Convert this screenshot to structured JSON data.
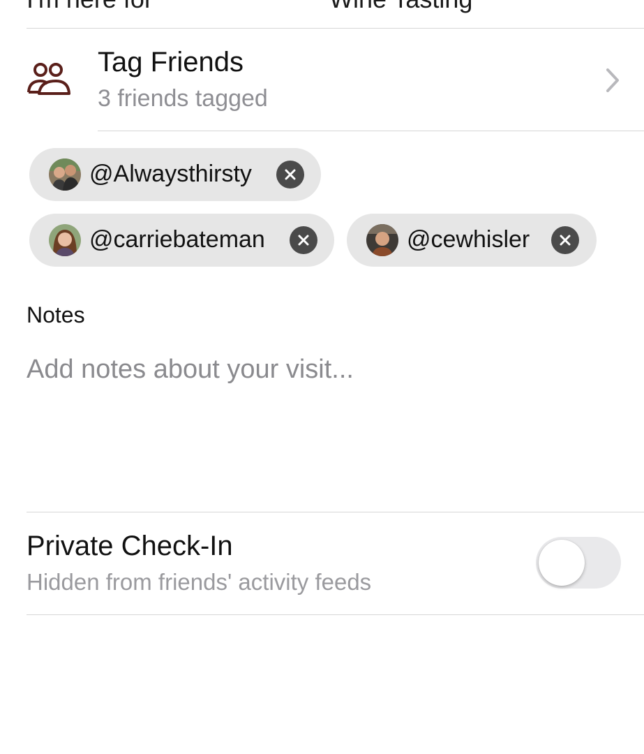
{
  "header_row": {
    "label": "I'm here for",
    "value": "Wine Tasting"
  },
  "tag_friends": {
    "title": "Tag Friends",
    "subtitle": "3 friends tagged",
    "icon": "people-icon",
    "accent_color": "#5a1f1a"
  },
  "tagged_friends": [
    {
      "handle": "@Alwaysthirsty",
      "avatar": "couple-photo"
    },
    {
      "handle": "@carriebateman",
      "avatar": "woman-photo"
    },
    {
      "handle": "@cewhisler",
      "avatar": "man-photo"
    }
  ],
  "notes": {
    "label": "Notes",
    "placeholder": "Add notes about your visit...",
    "value": ""
  },
  "private_checkin": {
    "title": "Private Check-In",
    "subtitle": "Hidden from friends' activity feeds",
    "enabled": false
  }
}
